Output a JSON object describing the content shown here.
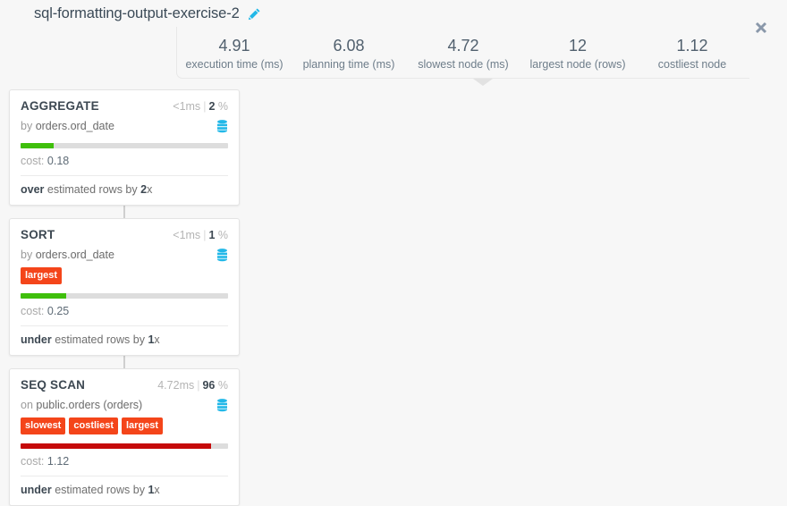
{
  "header": {
    "title": "sql-formatting-output-exercise-2",
    "edit_icon": "pencil-icon",
    "close_icon": "close-icon",
    "stats": [
      {
        "value": "4.91",
        "label": "execution time (ms)"
      },
      {
        "value": "6.08",
        "label": "planning time (ms)"
      },
      {
        "value": "4.72",
        "label": "slowest node (ms)"
      },
      {
        "value": "12",
        "label": "largest node (rows)"
      },
      {
        "value": "1.12",
        "label": "costliest node"
      }
    ]
  },
  "colors": {
    "badge": "#f4451a",
    "bar_good": "#3fbf0b",
    "bar_bad": "#c50a0a",
    "bar_track": "#dddddd",
    "accent_icon": "#22b8e8",
    "page_background": "#f7f7f7"
  },
  "nodes": [
    {
      "type": "AGGREGATE",
      "time": "<1ms",
      "separator": "|",
      "percent_value": "2",
      "percent_sign": "%",
      "relation_prefix": "by",
      "relation": "orders.ord_date",
      "db_icon": "database-icon",
      "badges": [],
      "bar_percent": 16,
      "bar_color": "#3fbf0b",
      "cost_label": "cost:",
      "cost_value": "0.18",
      "estimate_direction": "over",
      "estimate_text": "estimated rows by",
      "estimate_factor": "2",
      "estimate_suffix": "x"
    },
    {
      "type": "SORT",
      "time": "<1ms",
      "separator": "|",
      "percent_value": "1",
      "percent_sign": "%",
      "relation_prefix": "by",
      "relation": "orders.ord_date",
      "db_icon": "database-icon",
      "badges": [
        "largest"
      ],
      "bar_percent": 22,
      "bar_color": "#3fbf0b",
      "cost_label": "cost:",
      "cost_value": "0.25",
      "estimate_direction": "under",
      "estimate_text": "estimated rows by",
      "estimate_factor": "1",
      "estimate_suffix": "x"
    },
    {
      "type": "SEQ SCAN",
      "time": "4.72ms",
      "separator": "|",
      "percent_value": "96",
      "percent_sign": "%",
      "relation_prefix": "on",
      "relation": "public.orders (orders)",
      "db_icon": "database-icon",
      "badges": [
        "slowest",
        "costliest",
        "largest"
      ],
      "bar_percent": 92,
      "bar_color": "#c50a0a",
      "cost_label": "cost:",
      "cost_value": "1.12",
      "estimate_direction": "under",
      "estimate_text": "estimated rows by",
      "estimate_factor": "1",
      "estimate_suffix": "x"
    }
  ]
}
